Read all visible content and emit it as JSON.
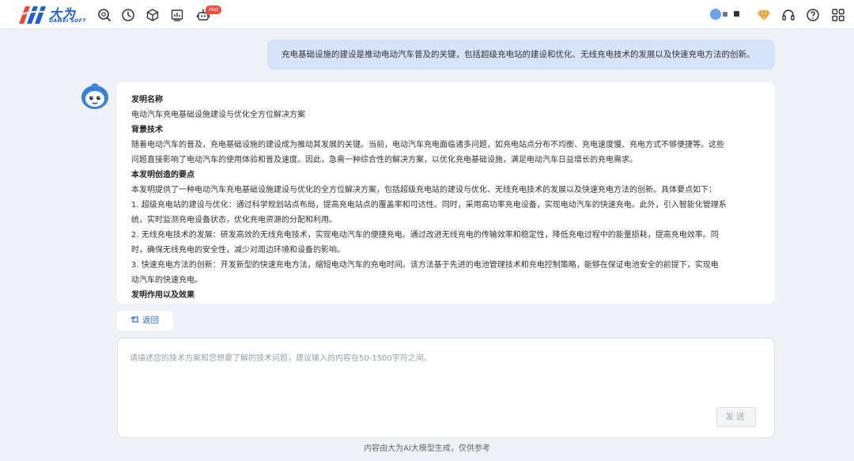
{
  "header": {
    "brand_name": "大为",
    "brand_sub": "DAWEI SOFT",
    "hot_badge": "Hot",
    "nav_icons": [
      "search-icon",
      "history-icon",
      "cube-icon",
      "report-icon",
      "robot-icon"
    ],
    "right_icons": [
      "vip-diamond-icon",
      "headset-icon",
      "help-icon",
      "grid-apps-icon"
    ],
    "colors": {
      "brand": "#1e5fd8",
      "hot": "#f04a3c",
      "diamond": "#e9a23b"
    }
  },
  "conversation": {
    "user_prompt": "充电基础设施的建设是推动电动汽车普及的关键，包括超级充电站的建设和优化、无线充电技术的发展以及快速充电方法的创新。",
    "answer_lines": [
      {
        "text": "发明名称",
        "head": true
      },
      {
        "text": "电动汽车充电基础设施建设与优化全方位解决方案",
        "head": false
      },
      {
        "text": "背景技术",
        "head": true
      },
      {
        "text": "随着电动汽车的普及，充电基础设施的建设成为推动其发展的关键。当前，电动汽车充电面临诸多问题，如充电站点分布不均衡、充电速度慢、充电方式不够便捷等。这些",
        "head": false
      },
      {
        "text": "问题直接影响了电动汽车的使用体验和普及速度。因此，急需一种综合性的解决方案，以优化充电基础设施，满足电动汽车日益增长的充电需求。",
        "head": false
      },
      {
        "text": "本发明创造的要点",
        "head": true
      },
      {
        "text": "本发明提供了一种电动汽车充电基础设施建设与优化的全方位解决方案，包括超级充电站的建设与优化、无线充电技术的发展以及快速充电方法的创新。具体要点如下：",
        "head": false
      },
      {
        "text": "1. 超级充电站的建设与优化：通过科学规划站点布局，提高充电站点的覆盖率和可达性。同时，采用高功率充电设备，实现电动汽车的快速充电。此外，引入智能化管理系",
        "head": false
      },
      {
        "text": "统，实时监测充电设备状态，优化充电资源的分配和利用。",
        "head": false
      },
      {
        "text": "2. 无线充电技术的发展：研发高效的无线充电技术，实现电动汽车的便捷充电。通过改进无线充电的传输效率和稳定性，降低充电过程中的能量损耗，提高充电效率。同",
        "head": false
      },
      {
        "text": "时，确保无线充电的安全性，减少对周边环境和设备的影响。",
        "head": false
      },
      {
        "text": "3. 快速充电方法的创新：开发新型的快速充电方法，缩短电动汽车的充电时间。该方法基于先进的电池管理技术和充电控制策略，能够在保证电池安全的前提下，实现电",
        "head": false
      },
      {
        "text": "动汽车的快速充电。",
        "head": false
      },
      {
        "text": "发明作用以及效果",
        "head": true
      }
    ]
  },
  "controls": {
    "back_label": "返回",
    "input_placeholder": "请描述您的技术方案和您想要了解的技术问题，建议输入的内容在50-1500字符之间。",
    "input_value": "",
    "send_label": "发送"
  },
  "footer": {
    "note": "内容由大为AI大模型生成，仅供参考"
  }
}
